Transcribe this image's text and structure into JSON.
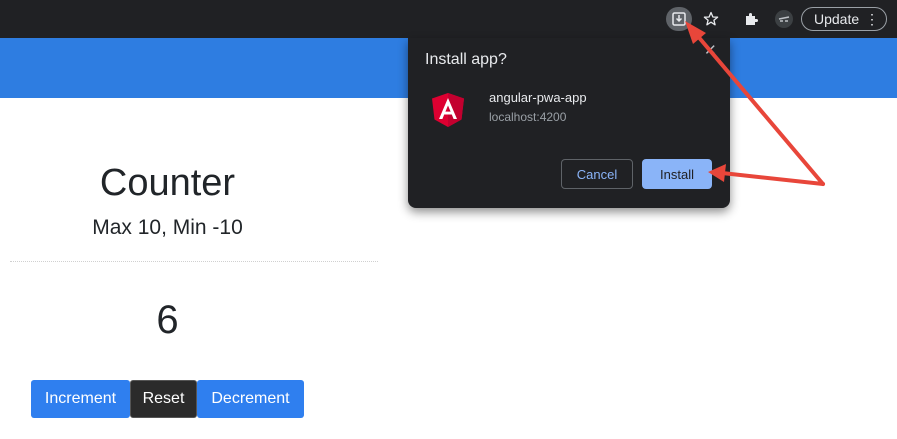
{
  "browser": {
    "update_label": "Update",
    "menu_glyph": "⋮",
    "icons": [
      "install-app-icon",
      "star-icon",
      "puzzle-icon",
      "incognito-avatar-icon",
      "kebab-menu-icon"
    ]
  },
  "page": {
    "title": "Counter",
    "subtitle": "Max 10, Min -10",
    "value": "6",
    "buttons": {
      "increment": "Increment",
      "reset": "Reset",
      "decrement": "Decrement"
    },
    "header_color": "#2e7de1"
  },
  "dialog": {
    "title": "Install app?",
    "close_glyph": "✕",
    "app_name": "angular-pwa-app",
    "app_origin": "localhost:4200",
    "cancel_label": "Cancel",
    "install_label": "Install"
  },
  "colors": {
    "annotation_arrow": "#e8463a",
    "dialog_bg": "#202124",
    "install_button": "#8ab4f8",
    "primary_button": "#2f7fef"
  }
}
